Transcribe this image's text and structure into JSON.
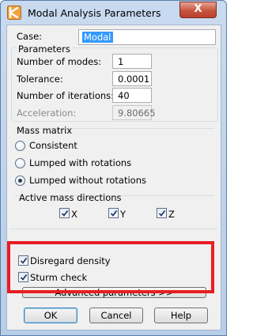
{
  "window": {
    "title": "Modal Analysis Parameters",
    "close_glyph": "X"
  },
  "case": {
    "label": "Case:",
    "value": "Modal"
  },
  "parameters": {
    "title": "Parameters",
    "fields": [
      {
        "label": "Number of modes:",
        "value": "1"
      },
      {
        "label": "Tolerance:",
        "value": "0.0001"
      },
      {
        "label": "Number of iterations:",
        "value": "40"
      },
      {
        "label": "Acceleration:",
        "value": "9.80665"
      }
    ]
  },
  "mass_matrix": {
    "title": "Mass matrix",
    "options": [
      {
        "label": "Consistent",
        "selected": false
      },
      {
        "label": "Lumped with rotations",
        "selected": false
      },
      {
        "label": "Lumped without rotations",
        "selected": true
      }
    ]
  },
  "directions": {
    "title": "Active mass directions",
    "items": [
      {
        "label": "X",
        "checked": true
      },
      {
        "label": "Y",
        "checked": true
      },
      {
        "label": "Z",
        "checked": true
      }
    ]
  },
  "options": {
    "disregard_density": "Disregard density",
    "sturm_check": "Sturm check",
    "advanced_button": "Advanced parameters >>"
  },
  "buttons": {
    "ok": "OK",
    "cancel": "Cancel",
    "help": "Help"
  },
  "colors": {
    "highlight": "#e81e24",
    "selection": "#3399ff"
  }
}
